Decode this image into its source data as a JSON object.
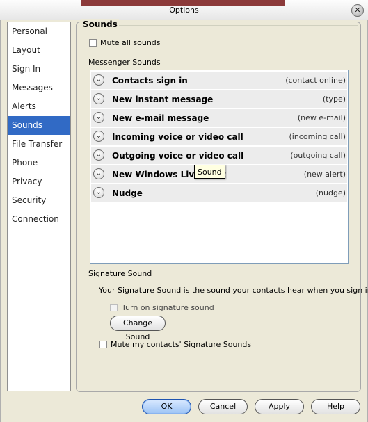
{
  "window": {
    "title": "Options",
    "close_glyph": "✕"
  },
  "nav": {
    "items": [
      {
        "label": "Personal"
      },
      {
        "label": "Layout"
      },
      {
        "label": "Sign In"
      },
      {
        "label": "Messages"
      },
      {
        "label": "Alerts"
      },
      {
        "label": "Sounds",
        "selected": true
      },
      {
        "label": "File Transfer"
      },
      {
        "label": "Phone"
      },
      {
        "label": "Privacy"
      },
      {
        "label": "Security"
      },
      {
        "label": "Connection"
      }
    ]
  },
  "sounds": {
    "heading": "Sounds",
    "mute_all_label": "Mute all sounds",
    "messenger_sounds_title": "Messenger Sounds",
    "list": [
      {
        "name": "Contacts sign in",
        "sound": "(contact online)"
      },
      {
        "name": "New instant message",
        "sound": "(type)"
      },
      {
        "name": "New e-mail message",
        "sound": "(new e-mail)"
      },
      {
        "name": "Incoming voice or video call",
        "sound": "(incoming call)"
      },
      {
        "name": "Outgoing voice or video call",
        "sound": "(outgoing call)"
      },
      {
        "name": "New Windows Live Alert",
        "sound": "(new alert)"
      },
      {
        "name": "Nudge",
        "sound": "(nudge)"
      }
    ],
    "chevron_glyph": "⌄",
    "tooltip": "Sound"
  },
  "signature": {
    "title": "Signature Sound",
    "description": "Your Signature Sound is the sound your contacts hear when you sign in",
    "turn_on_label": "Turn on signature sound",
    "change_button": "Change Sound",
    "mute_contacts_label": "Mute my contacts' Signature Sounds"
  },
  "footer": {
    "ok": "OK",
    "cancel": "Cancel",
    "apply": "Apply",
    "help": "Help"
  }
}
